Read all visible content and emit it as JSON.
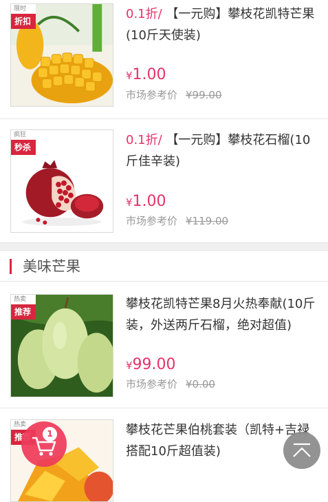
{
  "products": [
    {
      "tag_top": "限时",
      "tag_bottom": "折扣",
      "discount": "0.1折/",
      "title": "【一元购】攀枝花凯特芒果(10斤天使装)",
      "price_symbol": "¥",
      "price": "1.00",
      "market_label": "市场参考价",
      "market_price": "¥99.00"
    },
    {
      "tag_top": "疯狂",
      "tag_bottom": "秒杀",
      "discount": "0.1折/",
      "title": "【一元购】攀枝花石榴(10斤佳辛装)",
      "price_symbol": "¥",
      "price": "1.00",
      "market_label": "市场参考价",
      "market_price": "¥119.00"
    }
  ],
  "section": {
    "title": "美味芒果"
  },
  "section_products": [
    {
      "tag_top": "热卖",
      "tag_bottom": "推荐",
      "title": "攀枝花凯特芒果8月火热奉献(10斤装，外送两斤石榴，绝对超值)",
      "price_symbol": "¥",
      "price": "99.00",
      "market_label": "市场参考价",
      "market_price": "¥0.00"
    },
    {
      "tag_top": "热卖",
      "tag_bottom": "推荐",
      "title": "攀枝花芒果伯桃套装（凯特+吉禄搭配10斤超值装)"
    }
  ],
  "cart": {
    "count": "1"
  },
  "colors": {
    "accent": "#e5336a",
    "tag": "#d8263e",
    "cart": "#ee3b5b",
    "back_to_top": "#8a8a8a"
  },
  "icons": {
    "cart": "cart-icon",
    "back_to_top": "chevron-up-icon"
  }
}
